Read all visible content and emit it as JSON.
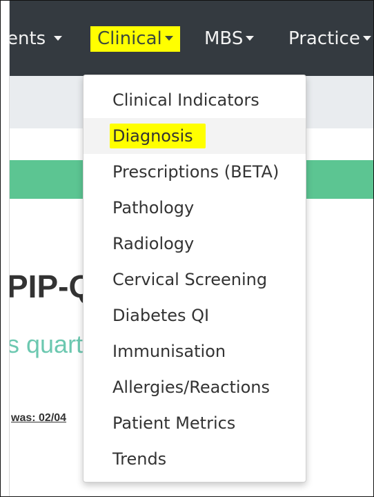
{
  "navbar": {
    "items": [
      {
        "label": "ents"
      },
      {
        "label": "Clinical"
      },
      {
        "label": "MBS"
      },
      {
        "label": "Practice"
      }
    ]
  },
  "dropdown": {
    "items": [
      {
        "label": "Clinical Indicators"
      },
      {
        "label": "Diagnosis"
      },
      {
        "label": "Prescriptions (BETA)"
      },
      {
        "label": "Pathology"
      },
      {
        "label": "Radiology"
      },
      {
        "label": "Cervical Screening"
      },
      {
        "label": "Diabetes QI"
      },
      {
        "label": "Immunisation"
      },
      {
        "label": "Allergies/Reactions"
      },
      {
        "label": "Patient Metrics"
      },
      {
        "label": "Trends"
      }
    ]
  },
  "background": {
    "heading": "PIP-Q",
    "subheading": "s quarte",
    "was_text": "was: 02/04"
  },
  "colors": {
    "navbar": "#343a40",
    "highlight": "#ffff00",
    "banner": "#5cc592",
    "subbar": "#e9ecef"
  }
}
